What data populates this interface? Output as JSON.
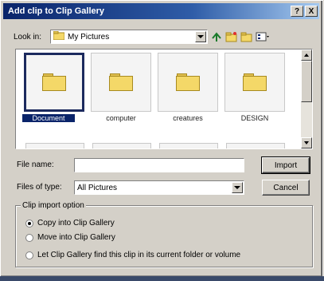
{
  "window": {
    "title": "Add clip to Clip Gallery",
    "help_label": "?",
    "close_label": "X"
  },
  "lookin": {
    "label": "Look in:",
    "value": "My Pictures"
  },
  "files": [
    {
      "name": "Document",
      "selected": true
    },
    {
      "name": "computer",
      "selected": false
    },
    {
      "name": "creatures",
      "selected": false
    },
    {
      "name": "DESIGN",
      "selected": false
    }
  ],
  "filename": {
    "label": "File name:",
    "value": ""
  },
  "filetype": {
    "label": "Files of type:",
    "value": "All Pictures"
  },
  "buttons": {
    "import": "Import",
    "cancel": "Cancel"
  },
  "options": {
    "legend": "Clip import option",
    "items": [
      {
        "label": "Copy into Clip Gallery",
        "checked": true
      },
      {
        "label": "Move into Clip Gallery",
        "checked": false
      },
      {
        "label": "Let Clip Gallery find this clip in its current folder or volume",
        "checked": false
      }
    ]
  },
  "icons": [
    "up-folder-icon",
    "new-folder-icon",
    "desktop-icon",
    "views-icon",
    "folder-icon"
  ]
}
